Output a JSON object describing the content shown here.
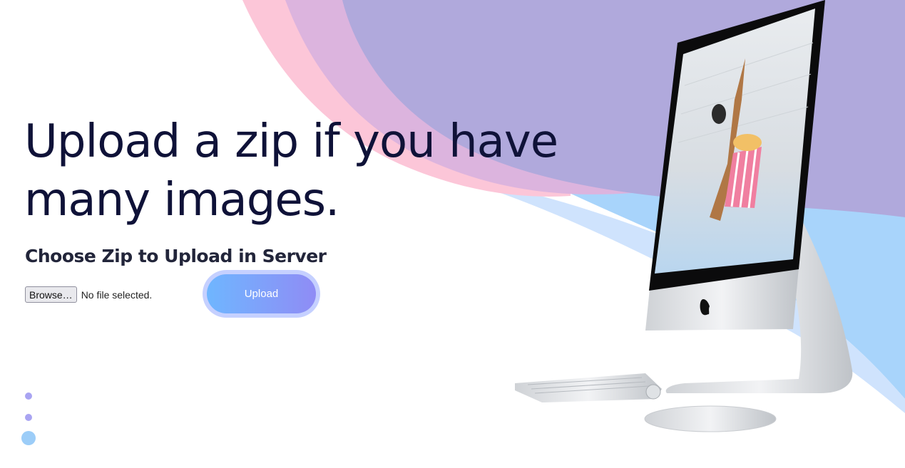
{
  "hero": {
    "title": "Upload a zip if you have many images.",
    "subtitle": "Choose Zip to Upload in Server"
  },
  "file_input": {
    "browse_label": "Browse…",
    "status": "No file selected."
  },
  "upload": {
    "label": "Upload"
  },
  "colors": {
    "title": "#0f1238",
    "wave_pink": "#fcc6d8",
    "wave_mauve": "#dcb4de",
    "wave_purple": "#b0a9dc",
    "wave_blue": "#a8d4fb",
    "button_start": "#6fb6ff",
    "button_end": "#8f8cf5"
  },
  "icons": {
    "pagination": [
      "dot-small",
      "dot-small",
      "dot-large"
    ],
    "illustration": "imac-keyboard-mouse"
  }
}
